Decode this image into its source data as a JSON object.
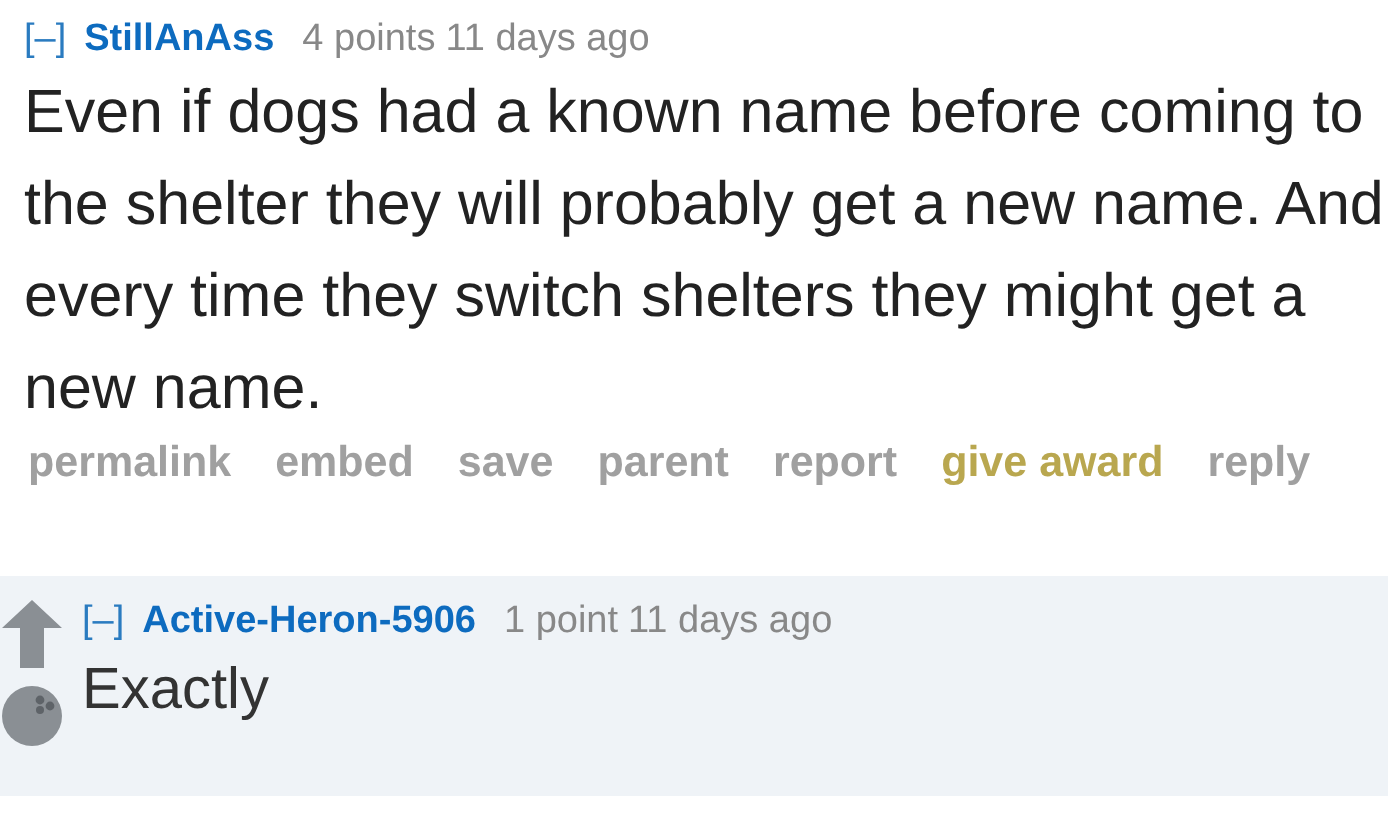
{
  "comments": [
    {
      "collapse": "[–]",
      "author": "StillAnAss",
      "score": "4 points",
      "time": "11 days ago",
      "body": "Even if dogs had a known name before coming to the shelter they will probably get a new name. And every time they switch shelters they might get a new name.",
      "actions": [
        {
          "label": "permalink",
          "color": "#a0a0a0"
        },
        {
          "label": "embed",
          "color": "#a0a0a0"
        },
        {
          "label": "save",
          "color": "#a0a0a0"
        },
        {
          "label": "parent",
          "color": "#a0a0a0"
        },
        {
          "label": "report",
          "color": "#a0a0a0"
        },
        {
          "label": "give award",
          "color": "#b9a74f"
        },
        {
          "label": "reply",
          "color": "#a0a0a0"
        }
      ]
    },
    {
      "collapse": "[–]",
      "author": "Active-Heron-5906",
      "score": "1 point",
      "time": "11 days ago",
      "body": "Exactly"
    }
  ]
}
